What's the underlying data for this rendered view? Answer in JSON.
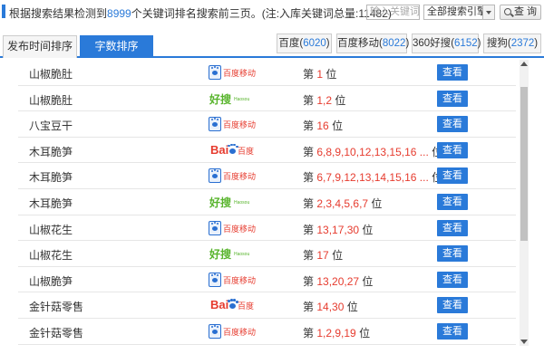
{
  "header": {
    "summary_prefix": "根据搜索结果检测到",
    "summary_count": "8999",
    "summary_suffix": "个关键词排名搜索前三页。(注:入库关键词总量:11482)",
    "keyword_placeholder": "输入关键词",
    "engine_select_value": "全部搜索引擎",
    "query_label": "查 询"
  },
  "tabs": [
    {
      "label": "发布时间排序",
      "active": false
    },
    {
      "label": "字数排序",
      "active": true
    }
  ],
  "engine_counts": [
    {
      "name": "百度",
      "count": "6020"
    },
    {
      "name": "百度移动",
      "count": "8022"
    },
    {
      "name": "360好搜",
      "count": "6152"
    },
    {
      "name": "搜狗",
      "count": "2372"
    }
  ],
  "rank_prefix": "第",
  "rank_suffix": "位",
  "view_label": "查看",
  "logos": {
    "baidu_mobile": "百度移动",
    "haosou_brand": "好搜",
    "haosou_sub": "Haosou",
    "baidu_bai": "Bai",
    "baidu_du": "百度"
  },
  "rows": [
    {
      "keyword": "山椒脆肚",
      "engine": "baidu-mobile",
      "positions": "1"
    },
    {
      "keyword": "山椒脆肚",
      "engine": "haosou",
      "positions": "1,2"
    },
    {
      "keyword": "八宝豆干",
      "engine": "baidu-mobile",
      "positions": "16"
    },
    {
      "keyword": "木耳脆笋",
      "engine": "baidu",
      "positions": "6,8,9,10,12,13,15,16 ..."
    },
    {
      "keyword": "木耳脆笋",
      "engine": "baidu-mobile",
      "positions": "6,7,9,12,13,14,15,16 ..."
    },
    {
      "keyword": "木耳脆笋",
      "engine": "haosou",
      "positions": "2,3,4,5,6,7"
    },
    {
      "keyword": "山椒花生",
      "engine": "baidu-mobile",
      "positions": "13,17,30"
    },
    {
      "keyword": "山椒花生",
      "engine": "haosou",
      "positions": "17"
    },
    {
      "keyword": "山椒脆笋",
      "engine": "baidu-mobile",
      "positions": "13,20,27"
    },
    {
      "keyword": "金针菇零售",
      "engine": "baidu",
      "positions": "14,30"
    },
    {
      "keyword": "金针菇零售",
      "engine": "baidu-mobile",
      "positions": "1,2,9,19"
    }
  ],
  "colors": {
    "accent": "#2a7ad9",
    "rank_red": "#e63b2e",
    "haosou_green": "#58b42c"
  }
}
